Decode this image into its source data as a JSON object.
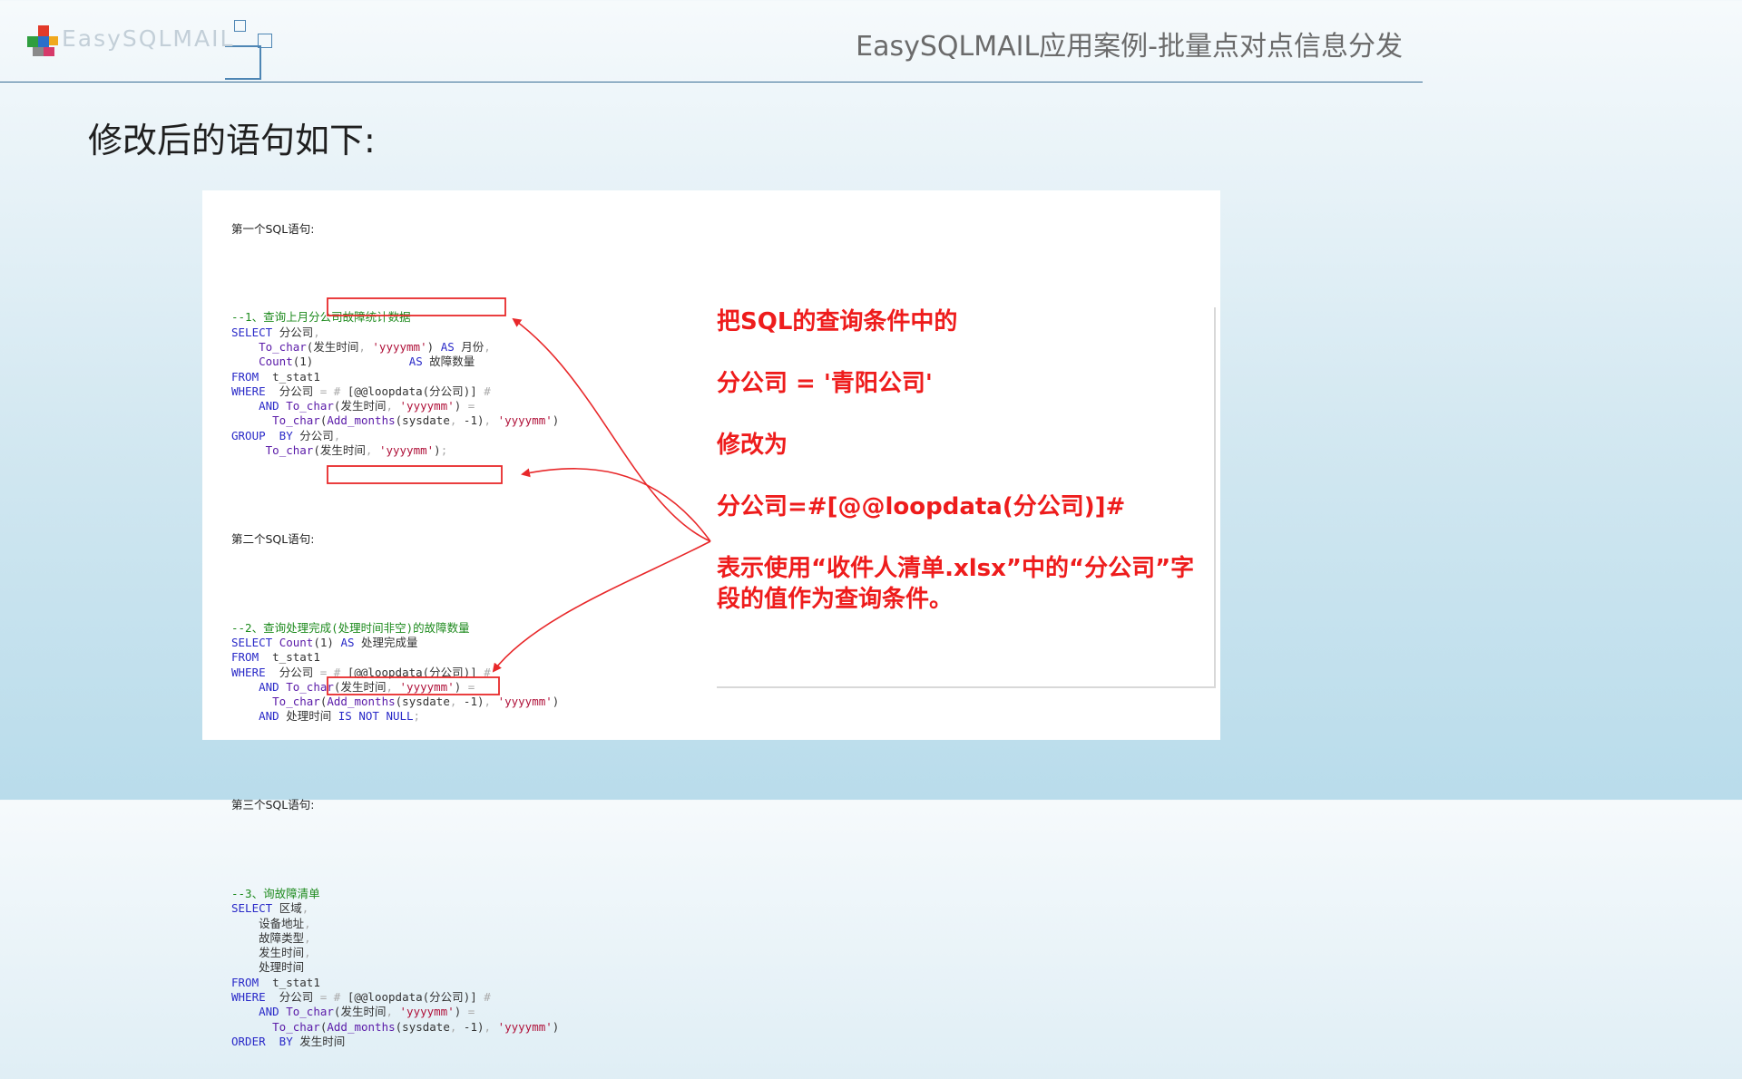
{
  "logo": {
    "text": "EasySQLMAIL"
  },
  "header": {
    "title": "EasySQLMAIL应用案例-批量点对点信息分发"
  },
  "page_title": "修改后的语句如下:",
  "code": {
    "sql1_header": "第一个SQL语句:",
    "sql1": [
      [
        [
          "cmt",
          "--1、查询上月分公司故障统计数据"
        ]
      ],
      [
        [
          "kw",
          "SELECT "
        ],
        [
          "cjk",
          "分公司"
        ],
        [
          "grey",
          ","
        ]
      ],
      [
        [
          "t",
          "    "
        ],
        [
          "fn",
          "To_char"
        ],
        [
          "t",
          "("
        ],
        [
          "cjk",
          "发生时间"
        ],
        [
          "grey",
          ", "
        ],
        [
          "str",
          "'yyyymm'"
        ],
        [
          "t",
          ") "
        ],
        [
          "kw",
          "AS "
        ],
        [
          "cjk",
          "月份"
        ],
        [
          "grey",
          ","
        ]
      ],
      [
        [
          "t",
          "    "
        ],
        [
          "fn",
          "Count"
        ],
        [
          "t",
          "(1)              "
        ],
        [
          "kw",
          "AS "
        ],
        [
          "cjk",
          "故障数量"
        ]
      ],
      [
        [
          "kw",
          "FROM"
        ],
        [
          "t",
          "  t_stat1"
        ]
      ],
      [
        [
          "kw",
          "WHERE"
        ],
        [
          "t",
          "  "
        ],
        [
          "cjk",
          "分公司"
        ],
        [
          "grey",
          " = "
        ],
        [
          "grey",
          "# "
        ],
        [
          "t",
          "[@@loopdata("
        ],
        [
          "cjk",
          "分公司"
        ],
        [
          "t",
          ")] "
        ],
        [
          "grey",
          "#"
        ]
      ],
      [
        [
          "t",
          "    "
        ],
        [
          "kw",
          "AND "
        ],
        [
          "fn",
          "To_char"
        ],
        [
          "t",
          "("
        ],
        [
          "cjk",
          "发生时间"
        ],
        [
          "grey",
          ", "
        ],
        [
          "str",
          "'yyyymm'"
        ],
        [
          "t",
          ")"
        ],
        [
          "grey",
          " ="
        ]
      ],
      [
        [
          "t",
          "      "
        ],
        [
          "fn",
          "To_char"
        ],
        [
          "t",
          "("
        ],
        [
          "fn",
          "Add_months"
        ],
        [
          "t",
          "(sysdate"
        ],
        [
          "grey",
          ", "
        ],
        [
          "t",
          "-1)"
        ],
        [
          "grey",
          ", "
        ],
        [
          "str",
          "'yyyymm'"
        ],
        [
          "t",
          ")"
        ]
      ],
      [
        [
          "kw",
          "GROUP  BY "
        ],
        [
          "cjk",
          "分公司"
        ],
        [
          "grey",
          ","
        ]
      ],
      [
        [
          "t",
          "     "
        ],
        [
          "fn",
          "To_char"
        ],
        [
          "t",
          "("
        ],
        [
          "cjk",
          "发生时间"
        ],
        [
          "grey",
          ", "
        ],
        [
          "str",
          "'yyyymm'"
        ],
        [
          "t",
          ")"
        ],
        [
          "grey",
          ";"
        ]
      ]
    ],
    "sql2_header": "第二个SQL语句:",
    "sql2": [
      [
        [
          "cmt",
          "--2、查询处理完成(处理时间非空)的故障数量"
        ]
      ],
      [
        [
          "kw",
          "SELECT "
        ],
        [
          "fn",
          "Count"
        ],
        [
          "t",
          "(1) "
        ],
        [
          "kw",
          "AS "
        ],
        [
          "cjk",
          "处理完成量"
        ]
      ],
      [
        [
          "kw",
          "FROM"
        ],
        [
          "t",
          "  t_stat1"
        ]
      ],
      [
        [
          "kw",
          "WHERE"
        ],
        [
          "t",
          "  "
        ],
        [
          "cjk",
          "分公司"
        ],
        [
          "grey",
          " = "
        ],
        [
          "grey",
          "# "
        ],
        [
          "t",
          "[@@loopdata("
        ],
        [
          "cjk",
          "分公司"
        ],
        [
          "t",
          ")] "
        ],
        [
          "grey",
          "#"
        ]
      ],
      [
        [
          "t",
          "    "
        ],
        [
          "kw",
          "AND "
        ],
        [
          "fn",
          "To_char"
        ],
        [
          "t",
          "("
        ],
        [
          "cjk",
          "发生时间"
        ],
        [
          "grey",
          ", "
        ],
        [
          "str",
          "'yyyymm'"
        ],
        [
          "t",
          ")"
        ],
        [
          "grey",
          " ="
        ]
      ],
      [
        [
          "t",
          "      "
        ],
        [
          "fn",
          "To_char"
        ],
        [
          "t",
          "("
        ],
        [
          "fn",
          "Add_months"
        ],
        [
          "t",
          "(sysdate"
        ],
        [
          "grey",
          ", "
        ],
        [
          "t",
          "-1)"
        ],
        [
          "grey",
          ", "
        ],
        [
          "str",
          "'yyyymm'"
        ],
        [
          "t",
          ")"
        ]
      ],
      [
        [
          "t",
          "    "
        ],
        [
          "kw",
          "AND "
        ],
        [
          "cjk",
          "处理时间"
        ],
        [
          "kw",
          " IS NOT NULL"
        ],
        [
          "grey",
          ";"
        ]
      ]
    ],
    "sql3_header": "第三个SQL语句:",
    "sql3": [
      [
        [
          "cmt",
          "--3、询故障清单"
        ]
      ],
      [
        [
          "kw",
          "SELECT "
        ],
        [
          "cjk",
          "区域"
        ],
        [
          "grey",
          ","
        ]
      ],
      [
        [
          "t",
          "    "
        ],
        [
          "cjk",
          "设备地址"
        ],
        [
          "grey",
          ","
        ]
      ],
      [
        [
          "t",
          "    "
        ],
        [
          "cjk",
          "故障类型"
        ],
        [
          "grey",
          ","
        ]
      ],
      [
        [
          "t",
          "    "
        ],
        [
          "cjk",
          "发生时间"
        ],
        [
          "grey",
          ","
        ]
      ],
      [
        [
          "t",
          "    "
        ],
        [
          "cjk",
          "处理时间"
        ]
      ],
      [
        [
          "kw",
          "FROM"
        ],
        [
          "t",
          "  t_stat1"
        ]
      ],
      [
        [
          "kw",
          "WHERE"
        ],
        [
          "t",
          "  "
        ],
        [
          "cjk",
          "分公司"
        ],
        [
          "grey",
          " = "
        ],
        [
          "grey",
          "# "
        ],
        [
          "t",
          "[@@loopdata("
        ],
        [
          "cjk",
          "分公司"
        ],
        [
          "t",
          ")] "
        ],
        [
          "grey",
          "#"
        ]
      ],
      [
        [
          "t",
          "    "
        ],
        [
          "kw",
          "AND "
        ],
        [
          "fn",
          "To_char"
        ],
        [
          "t",
          "("
        ],
        [
          "cjk",
          "发生时间"
        ],
        [
          "grey",
          ", "
        ],
        [
          "str",
          "'yyyymm'"
        ],
        [
          "t",
          ")"
        ],
        [
          "grey",
          " ="
        ]
      ],
      [
        [
          "t",
          "      "
        ],
        [
          "fn",
          "To_char"
        ],
        [
          "t",
          "("
        ],
        [
          "fn",
          "Add_months"
        ],
        [
          "t",
          "(sysdate"
        ],
        [
          "grey",
          ", "
        ],
        [
          "t",
          "-1)"
        ],
        [
          "grey",
          ", "
        ],
        [
          "str",
          "'yyyymm'"
        ],
        [
          "t",
          ")"
        ]
      ],
      [
        [
          "kw",
          "ORDER  BY "
        ],
        [
          "cjk",
          "发生时间"
        ]
      ]
    ]
  },
  "note": {
    "line1": "把SQL的查询条件中的",
    "line2": "分公司 = '青阳公司'",
    "line3": "修改为",
    "line4": "分公司=#[@@loopdata(分公司)]#",
    "line5": "表示使用“收件人清单.xlsx”中的“分公司”字段的值作为查询条件。"
  },
  "colors": {
    "highlight_red": "#e8282a",
    "header_rule": "#3a6d94",
    "sql_keyword": "#2a2ac8",
    "sql_comment": "#1d8a1d",
    "sql_string": "#b0123a"
  }
}
